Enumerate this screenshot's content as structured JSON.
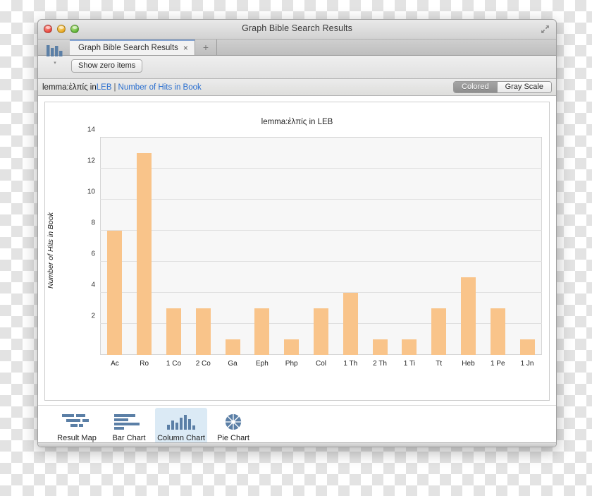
{
  "window": {
    "title": "Graph Bible Search Results",
    "expand_icon": "expand-arrows-icon",
    "traffic_lights": [
      "close-button",
      "minimize-button",
      "zoom-button"
    ]
  },
  "tabs": {
    "items": [
      {
        "label": "Graph Bible Search Results",
        "close": "×",
        "active": true
      }
    ],
    "add_label": "+"
  },
  "toolbar": {
    "app_icon": "bar-chart-app-icon",
    "caret": "▾",
    "show_zero_label": "Show zero items"
  },
  "breadcrumb": {
    "prefix": "lemma:ἐλπίς in ",
    "link1": "LEB",
    "separator": "|",
    "link2": "Number of Hits in Book"
  },
  "color_mode": {
    "options": [
      "Colored",
      "Gray Scale"
    ],
    "selected": "Colored"
  },
  "chart_data": {
    "type": "bar",
    "title": "lemma:ἐλπίς in LEB",
    "xlabel": "",
    "ylabel": "Number of Hits in Book",
    "ylim": [
      0,
      14
    ],
    "yticks": [
      14,
      12,
      10,
      8,
      6,
      4,
      2
    ],
    "grid": true,
    "legend": "none",
    "bar_color": "#f9c48a",
    "plot_background": "#f7f7f7",
    "categories": [
      "Ac",
      "Ro",
      "1 Co",
      "2 Co",
      "Ga",
      "Eph",
      "Php",
      "Col",
      "1 Th",
      "2 Th",
      "1 Ti",
      "Tt",
      "Heb",
      "1 Pe",
      "1 Jn"
    ],
    "values": [
      8,
      13,
      3,
      3,
      1,
      3,
      1,
      3,
      4,
      1,
      1,
      3,
      5,
      3,
      1
    ]
  },
  "chart_types": {
    "items": [
      {
        "label": "Result Map",
        "icon": "result-map-icon",
        "selected": false
      },
      {
        "label": "Bar Chart",
        "icon": "bar-chart-icon",
        "selected": false
      },
      {
        "label": "Column Chart",
        "icon": "column-chart-icon",
        "selected": true
      },
      {
        "label": "Pie Chart",
        "icon": "pie-chart-icon",
        "selected": false
      }
    ]
  }
}
